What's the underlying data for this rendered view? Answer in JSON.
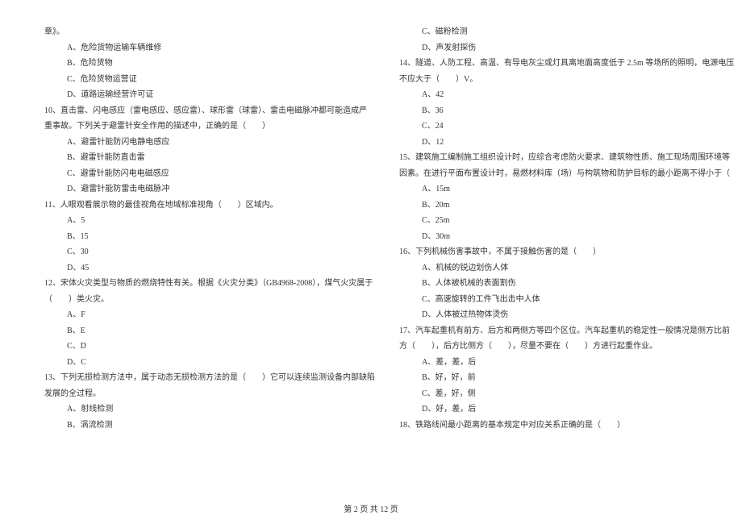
{
  "leftColumn": {
    "topFragment": "章》。",
    "q9_options": [
      "A、危险货物运输车辆维修",
      "B、危险货物",
      "C、危险货物运营证",
      "D、道路运输经营许可证"
    ],
    "q10_line1": "10、直击雷、闪电感应（雷电感应、感应雷）、球形雷（球雷）、雷击电磁脉冲都可能造成严",
    "q10_line2": "重事故。下列关于避雷针安全作用的描述中，正确的是（　　）",
    "q10_options": [
      "A、避雷针能防闪电静电感应",
      "B、避雷针能防直击雷",
      "C、避雷针能防闪电电磁感应",
      "D、避雷针能防雷击电磁脉冲"
    ],
    "q11_line1": "11、人眼观看展示物的最佳视角在地域标准视角（　　）区域内。",
    "q11_options": [
      "A、5",
      "B、15",
      "C、30",
      "D、45"
    ],
    "q12_line1": "12、宋体火灾类型与物质的燃烧特性有关。根据《火灾分类》（GB4968-2008），煤气火灾属于",
    "q12_line2": "（　　）类火灾。",
    "q12_options": [
      "A、F",
      "B、E",
      "C、D",
      "D、C"
    ],
    "q13_line1": "13、下列无损检测方法中，属于动态无损检测方法的是（　　）它可以连续监测设备内部缺陷",
    "q13_line2": "发展的全过程。",
    "q13_options": [
      "A、射线检测",
      "B、涡流检测"
    ]
  },
  "rightColumn": {
    "q13_options_cont": [
      "C、磁粉检测",
      "D、声发射探伤"
    ],
    "q14_line1": "14、隧道、人防工程、高温、有导电灰尘或灯具离地面高度低于 2.5m 等场所的照明，电源电压",
    "q14_line2": "不应大于（　　）V。",
    "q14_options": [
      "A、42",
      "B、36",
      "C、24",
      "D、12"
    ],
    "q15_line1": "15、建筑施工编制施工组织设计时，应综合考虑防火要求、建筑物性质、施工现场周围环境等",
    "q15_line2": "因素。在进行平面布置设计时，易燃材料库（场）与构筑物和防护目标的最小距离不得小于（　　）",
    "q15_options": [
      "A、15m",
      "B、20m",
      "C、25m",
      "D、30m"
    ],
    "q16_line1": "16、下列机械伤害事故中，不属于接触伤害的是（　　）",
    "q16_options": [
      "A、机械的锐边划伤人体",
      "B、人体被机械的表面割伤",
      "C、高速旋转的工件飞出击中人体",
      "D、人体被过热物体烫伤"
    ],
    "q17_line1": "17、汽车起重机有前方、后方和两侧方等四个区位。汽车起重机的稳定性一般情况是侧方比前",
    "q17_line2": "方（　　），后方比侧方（　　），尽量不要在（　　）方进行起重作业。",
    "q17_options": [
      "A、差，差，后",
      "B、好，好，前",
      "C、差，好，侧",
      "D、好，差，后"
    ],
    "q18_line1": "18、铁路线间最小距离的基本规定中对应关系正确的是（　　）"
  },
  "footer": "第 2 页 共 12 页"
}
